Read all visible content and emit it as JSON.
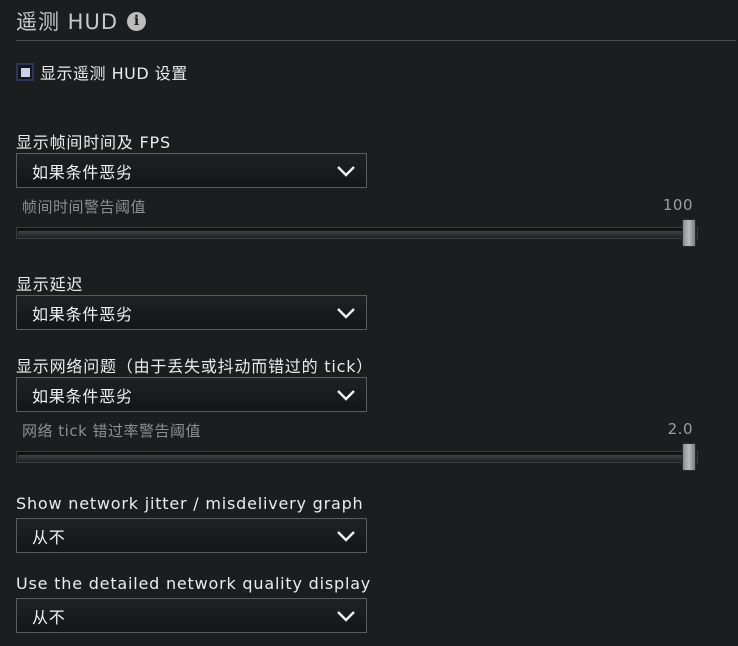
{
  "header": {
    "title": "遥测 HUD",
    "info_icon": "info-icon"
  },
  "checkbox": {
    "label": "显示遥测 HUD 设置",
    "checked": true
  },
  "sections": {
    "frametime": {
      "label": "显示帧间时间及 FPS",
      "dropdown_value": "如果条件恶劣",
      "slider_label": "帧间时间警告阈值",
      "slider_value": "100",
      "slider_fraction": 1.0
    },
    "latency": {
      "label": "显示延迟",
      "dropdown_value": "如果条件恶劣"
    },
    "network_problems": {
      "label": "显示网络问题（由于丢失或抖动而错过的 tick）",
      "dropdown_value": "如果条件恶劣",
      "slider_label": "网络 tick 错过率警告阈值",
      "slider_value": "2.0",
      "slider_fraction": 1.0
    },
    "jitter_graph": {
      "label": "Show network jitter / misdelivery graph",
      "dropdown_value": "从不"
    },
    "detailed_quality": {
      "label": "Use the detailed network quality display",
      "dropdown_value": "从不"
    }
  },
  "icons": {
    "dropdown_arrow": "chevron-down-icon"
  },
  "colors": {
    "background": "#1c1d1f",
    "text": "#ececec",
    "muted_text": "#8d8f93",
    "checkbox_fill": "#c8d4e8"
  }
}
